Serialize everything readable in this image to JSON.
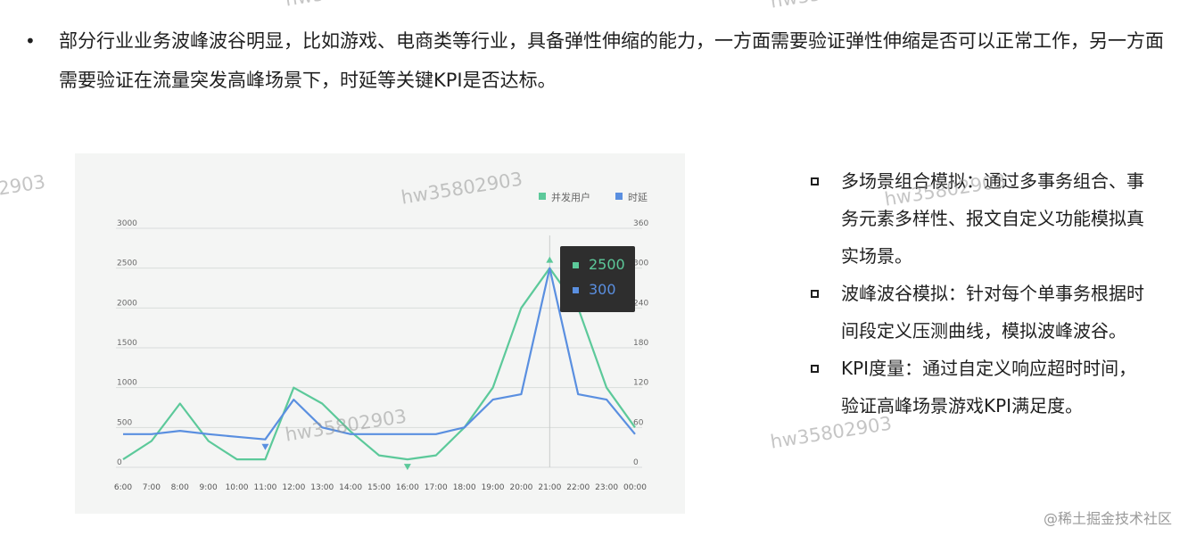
{
  "top_bullet": {
    "marker": "•",
    "text": "部分行业业务波峰波谷明显，比如游戏、电商类等行业，具备弹性伸缩的能力，一方面需要验证弹性伸缩是否可以正常工作，另一方面需要验证在流量突发高峰场景下，时延等关键KPI是否达标。"
  },
  "right_list": [
    {
      "text": "多场景组合模拟：通过多事务组合、事务元素多样性、报文自定义功能模拟真实场景。"
    },
    {
      "text": "波峰波谷模拟：针对每个单事务根据时间段定义压测曲线，模拟波峰波谷。"
    },
    {
      "text": "KPI度量：通过自定义响应超时时间，验证高峰场景游戏KPI满足度。"
    }
  ],
  "watermarks": [
    "hw35802903",
    "hw35802903",
    "2903",
    "hw35802903",
    "hw35802903",
    "hw35802903",
    "hw35802903"
  ],
  "footer_brand": "@稀土掘金技术社区",
  "chart_data": {
    "type": "line",
    "categories": [
      "6:00",
      "7:00",
      "8:00",
      "9:00",
      "10:00",
      "11:00",
      "12:00",
      "13:00",
      "14:00",
      "15:00",
      "16:00",
      "17:00",
      "18:00",
      "19:00",
      "20:00",
      "21:00",
      "22:00",
      "23:00",
      "00:00"
    ],
    "series": [
      {
        "name": "并发用户",
        "axis": "left",
        "color": "#5cc99a",
        "values": [
          100,
          330,
          800,
          330,
          100,
          100,
          1000,
          800,
          450,
          150,
          100,
          150,
          500,
          1000,
          2000,
          2500,
          2000,
          1000,
          500
        ]
      },
      {
        "name": "时延",
        "axis": "right",
        "color": "#5a8fe0",
        "values": [
          50,
          50,
          55,
          50,
          46,
          42,
          102,
          60,
          50,
          50,
          50,
          50,
          60,
          102,
          110,
          300,
          110,
          102,
          50
        ]
      }
    ],
    "y_left": {
      "ticks": [
        0,
        500,
        1000,
        1500,
        2000,
        2500,
        3000
      ],
      "range": [
        0,
        3000
      ]
    },
    "y_right": {
      "ticks": [
        0,
        60,
        120,
        180,
        240,
        300,
        360
      ],
      "range": [
        0,
        360
      ]
    },
    "grid": true,
    "legend_position": "top-right",
    "markers": [
      {
        "series": 0,
        "index": 10,
        "kind": "min"
      },
      {
        "series": 1,
        "index": 5,
        "kind": "min"
      },
      {
        "series": 0,
        "index": 15,
        "kind": "max"
      }
    ],
    "tooltip": {
      "index": 15,
      "rows": [
        {
          "value": "2500",
          "color": "#5cc99a"
        },
        {
          "value": "300",
          "color": "#5a8fe0"
        }
      ]
    }
  }
}
